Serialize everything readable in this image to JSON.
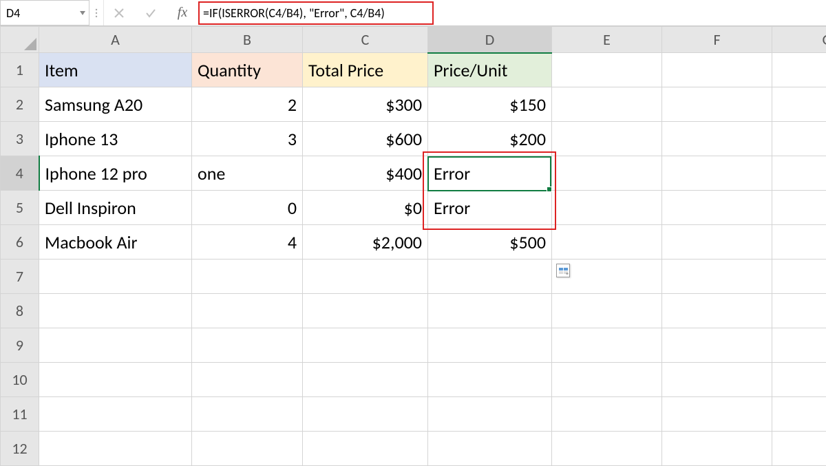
{
  "nameBox": {
    "cellRef": "D4"
  },
  "formulaBar": {
    "value": "=IF(ISERROR(C4/B4), \"Error\", C4/B4)"
  },
  "columns": [
    "A",
    "B",
    "C",
    "D",
    "E",
    "F",
    "G"
  ],
  "rowHeaders": [
    "1",
    "2",
    "3",
    "4",
    "5",
    "6",
    "7",
    "8",
    "9",
    "10",
    "11",
    "12"
  ],
  "selectedCell": "D4",
  "cells": {
    "A1": "Item",
    "B1": "Quantity",
    "C1": "Total Price",
    "D1": "Price/Unit",
    "A2": "Samsung A20",
    "B2": "2",
    "C2": "$300",
    "D2": "$150",
    "A3": "Iphone 13",
    "B3": "3",
    "C3": "$600",
    "D3": "$200",
    "A4": "Iphone 12 pro",
    "B4": "one",
    "C4": "$400",
    "D4": "Error",
    "A5": "Dell Inspiron",
    "B5": "0",
    "C5": "$0",
    "D5": "Error",
    "A6": "Macbook Air",
    "B6": "4",
    "C6": "$2,000",
    "D6": "$500"
  }
}
